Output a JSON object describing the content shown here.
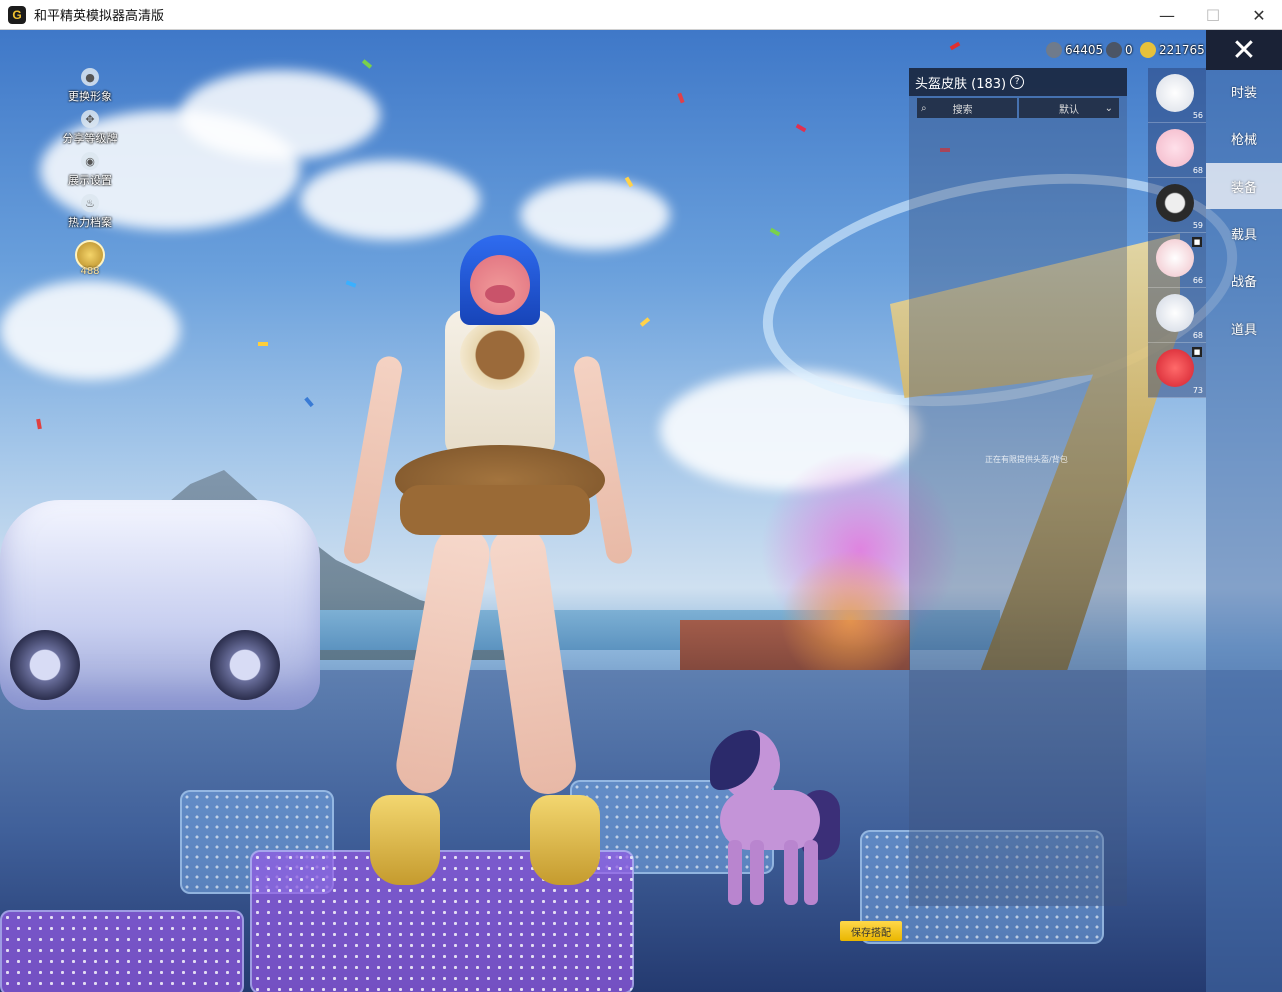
{
  "window": {
    "title": "和平精英模拟器高清版",
    "app_icon_letter": "G",
    "min_glyph": "—",
    "max_glyph": "☐",
    "close_glyph": "✕"
  },
  "left_menu": {
    "items": [
      {
        "label": "更换形象",
        "icon": "person-icon"
      },
      {
        "label": "分享等级牌",
        "icon": "share-icon"
      },
      {
        "label": "展示设置",
        "icon": "eye-icon"
      },
      {
        "label": "热力档案",
        "icon": "flame-icon"
      }
    ],
    "level_value": "488"
  },
  "currency": {
    "items": [
      {
        "icon": "coin-gray-icon",
        "value": "64405",
        "color": "#6f7b8c"
      },
      {
        "icon": "coin-a-icon",
        "value": "0",
        "color": "#4b5566"
      },
      {
        "icon": "uc-coin-icon",
        "value": "221765",
        "color": "#e7c13b"
      }
    ]
  },
  "skin_panel": {
    "title": "头盔皮肤 (183)",
    "help_glyph": "?",
    "search_placeholder": "搜索",
    "sort_label": "默认",
    "tip_text": "正在有限提供头盔/背包"
  },
  "items": [
    {
      "count": "56",
      "color": "#d8dde6",
      "tag": ""
    },
    {
      "count": "68",
      "color": "#f2b7c8",
      "tag": ""
    },
    {
      "count": "59",
      "color": "#2a2a2a",
      "tag": ""
    },
    {
      "count": "66",
      "color": "#f0c0c8",
      "tag": "■"
    },
    {
      "count": "68",
      "color": "#cfd6e2",
      "tag": ""
    },
    {
      "count": "73",
      "color": "#d2202e",
      "tag": "■"
    }
  ],
  "right_nav": {
    "close_glyph": "✕",
    "items": [
      {
        "label": "时装",
        "active": false
      },
      {
        "label": "枪械",
        "active": false
      },
      {
        "label": "装备",
        "active": true
      },
      {
        "label": "载具",
        "active": false
      },
      {
        "label": "战备",
        "active": false
      },
      {
        "label": "道具",
        "active": false
      }
    ]
  },
  "save_button": {
    "label": "保存搭配"
  }
}
